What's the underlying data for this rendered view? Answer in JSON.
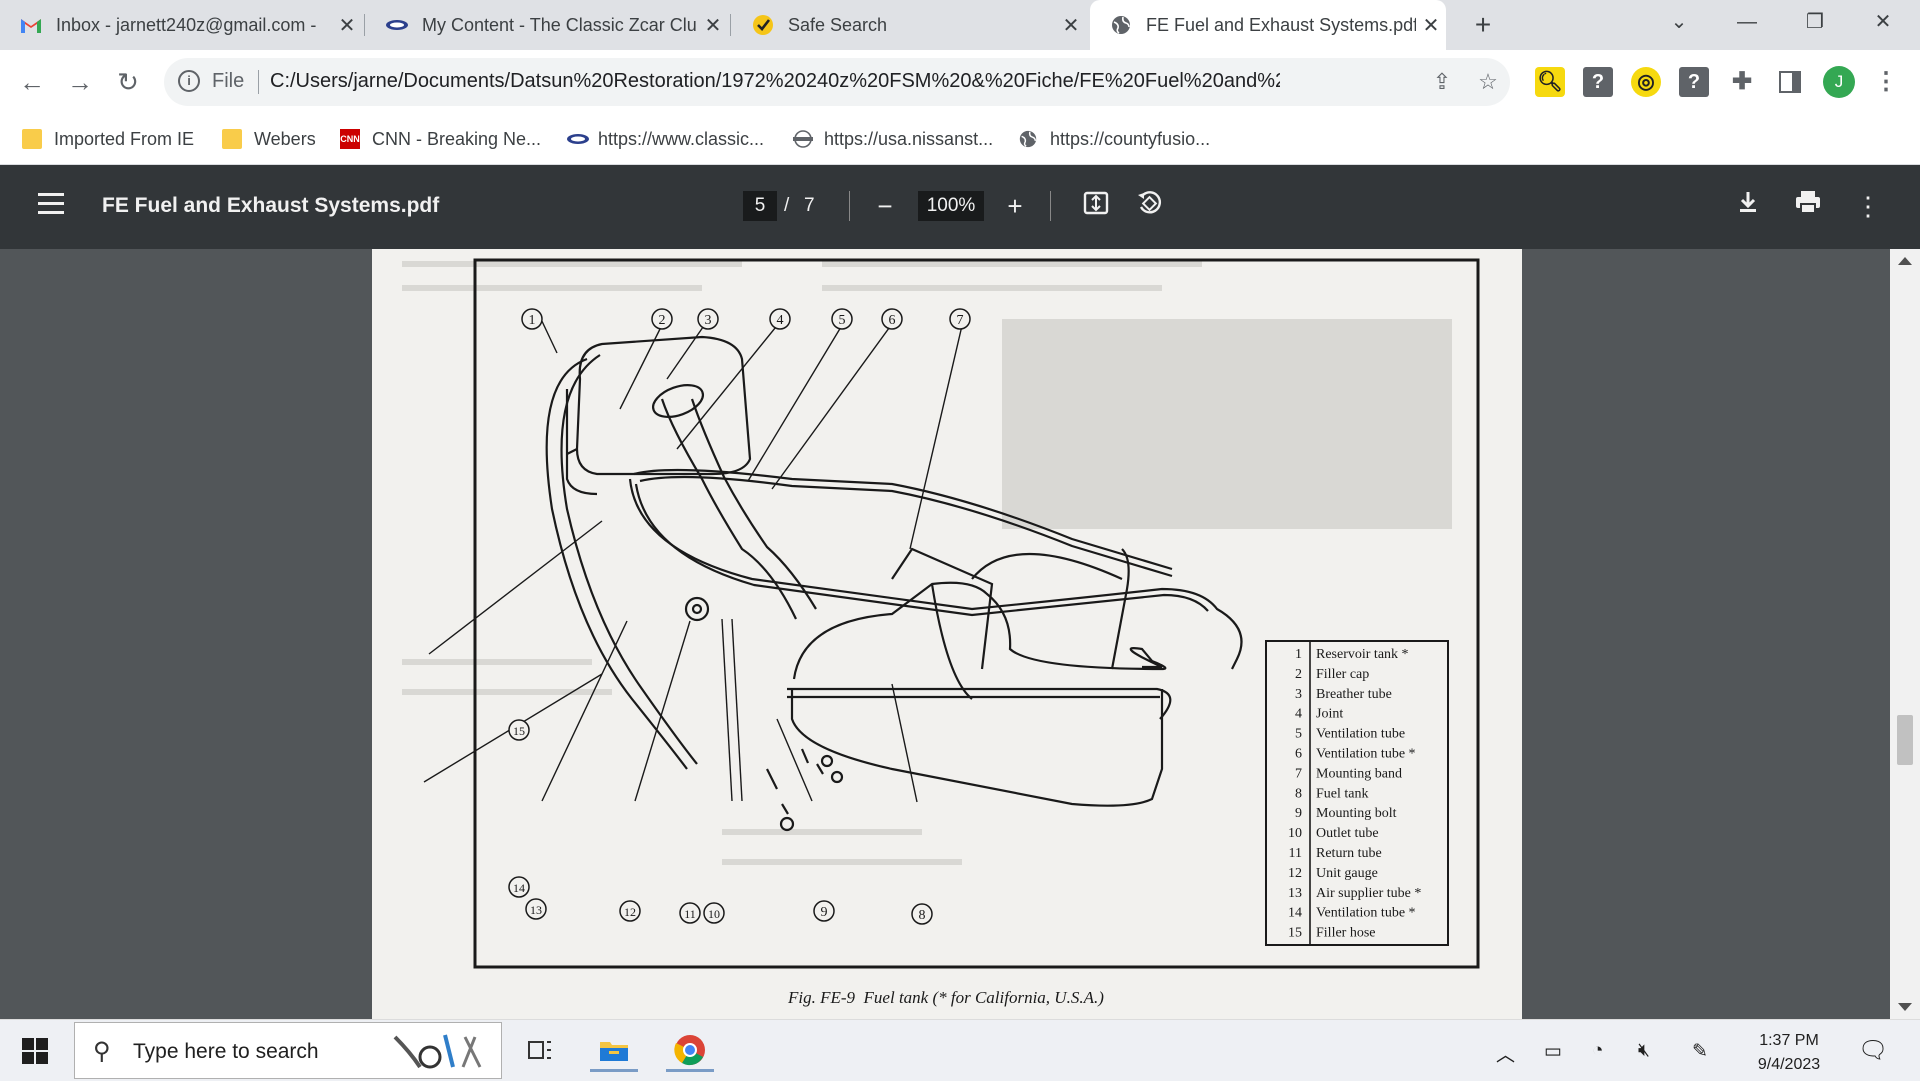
{
  "browser": {
    "tabs": [
      {
        "title": "Inbox - jarnett240z@gmail.com -",
        "icon": "gmail-icon",
        "active": false
      },
      {
        "title": "My Content - The Classic Zcar Clu",
        "icon": "classiczcar-icon",
        "active": false
      },
      {
        "title": "Safe Search",
        "icon": "checkmark-icon",
        "active": false
      },
      {
        "title": "FE Fuel and Exhaust Systems.pdf",
        "icon": "globe-icon",
        "active": true
      }
    ],
    "new_tab": "+",
    "address": {
      "scheme": "File",
      "url": "C:/Users/jarne/Documents/Datsun%20Restoration/1972%20240z%20FSM%20&%20Fiche/FE%20Fuel%20and%20Exhaust..."
    },
    "profile_initial": "J",
    "bookmarks": [
      {
        "label": "Imported From IE",
        "icon": "folder-icon"
      },
      {
        "label": "Webers",
        "icon": "folder-icon"
      },
      {
        "label": "CNN - Breaking Ne...",
        "icon": "cnn-icon"
      },
      {
        "label": "https://www.classic...",
        "icon": "classiczcar-icon"
      },
      {
        "label": "https://usa.nissanst...",
        "icon": "nissan-icon"
      },
      {
        "label": "https://countyfusio...",
        "icon": "globe-icon"
      }
    ]
  },
  "pdf": {
    "title": "FE Fuel and Exhaust Systems.pdf",
    "page_current": "5",
    "page_separator": "/",
    "page_total": "7",
    "zoom": "100%",
    "figure_caption": "Fig. FE-9  Fuel tank (* for California, U.S.A.)",
    "callouts": [
      "1",
      "2",
      "3",
      "4",
      "5",
      "6",
      "7",
      "8",
      "9",
      "10",
      "11",
      "12",
      "13",
      "14",
      "15"
    ],
    "legend": [
      {
        "num": "1",
        "name": "Reservoir tank *"
      },
      {
        "num": "2",
        "name": "Filler cap"
      },
      {
        "num": "3",
        "name": "Breather tube"
      },
      {
        "num": "4",
        "name": "Joint"
      },
      {
        "num": "5",
        "name": "Ventilation tube"
      },
      {
        "num": "6",
        "name": "Ventilation tube *"
      },
      {
        "num": "7",
        "name": "Mounting band"
      },
      {
        "num": "8",
        "name": "Fuel tank"
      },
      {
        "num": "9",
        "name": "Mounting bolt"
      },
      {
        "num": "10",
        "name": "Outlet tube"
      },
      {
        "num": "11",
        "name": "Return tube"
      },
      {
        "num": "12",
        "name": "Unit gauge"
      },
      {
        "num": "13",
        "name": "Air supplier tube *"
      },
      {
        "num": "14",
        "name": "Ventilation tube *"
      },
      {
        "num": "15",
        "name": "Filler hose"
      }
    ]
  },
  "taskbar": {
    "search_placeholder": "Type here to search",
    "time": "1:37 PM",
    "date": "9/4/2023"
  }
}
